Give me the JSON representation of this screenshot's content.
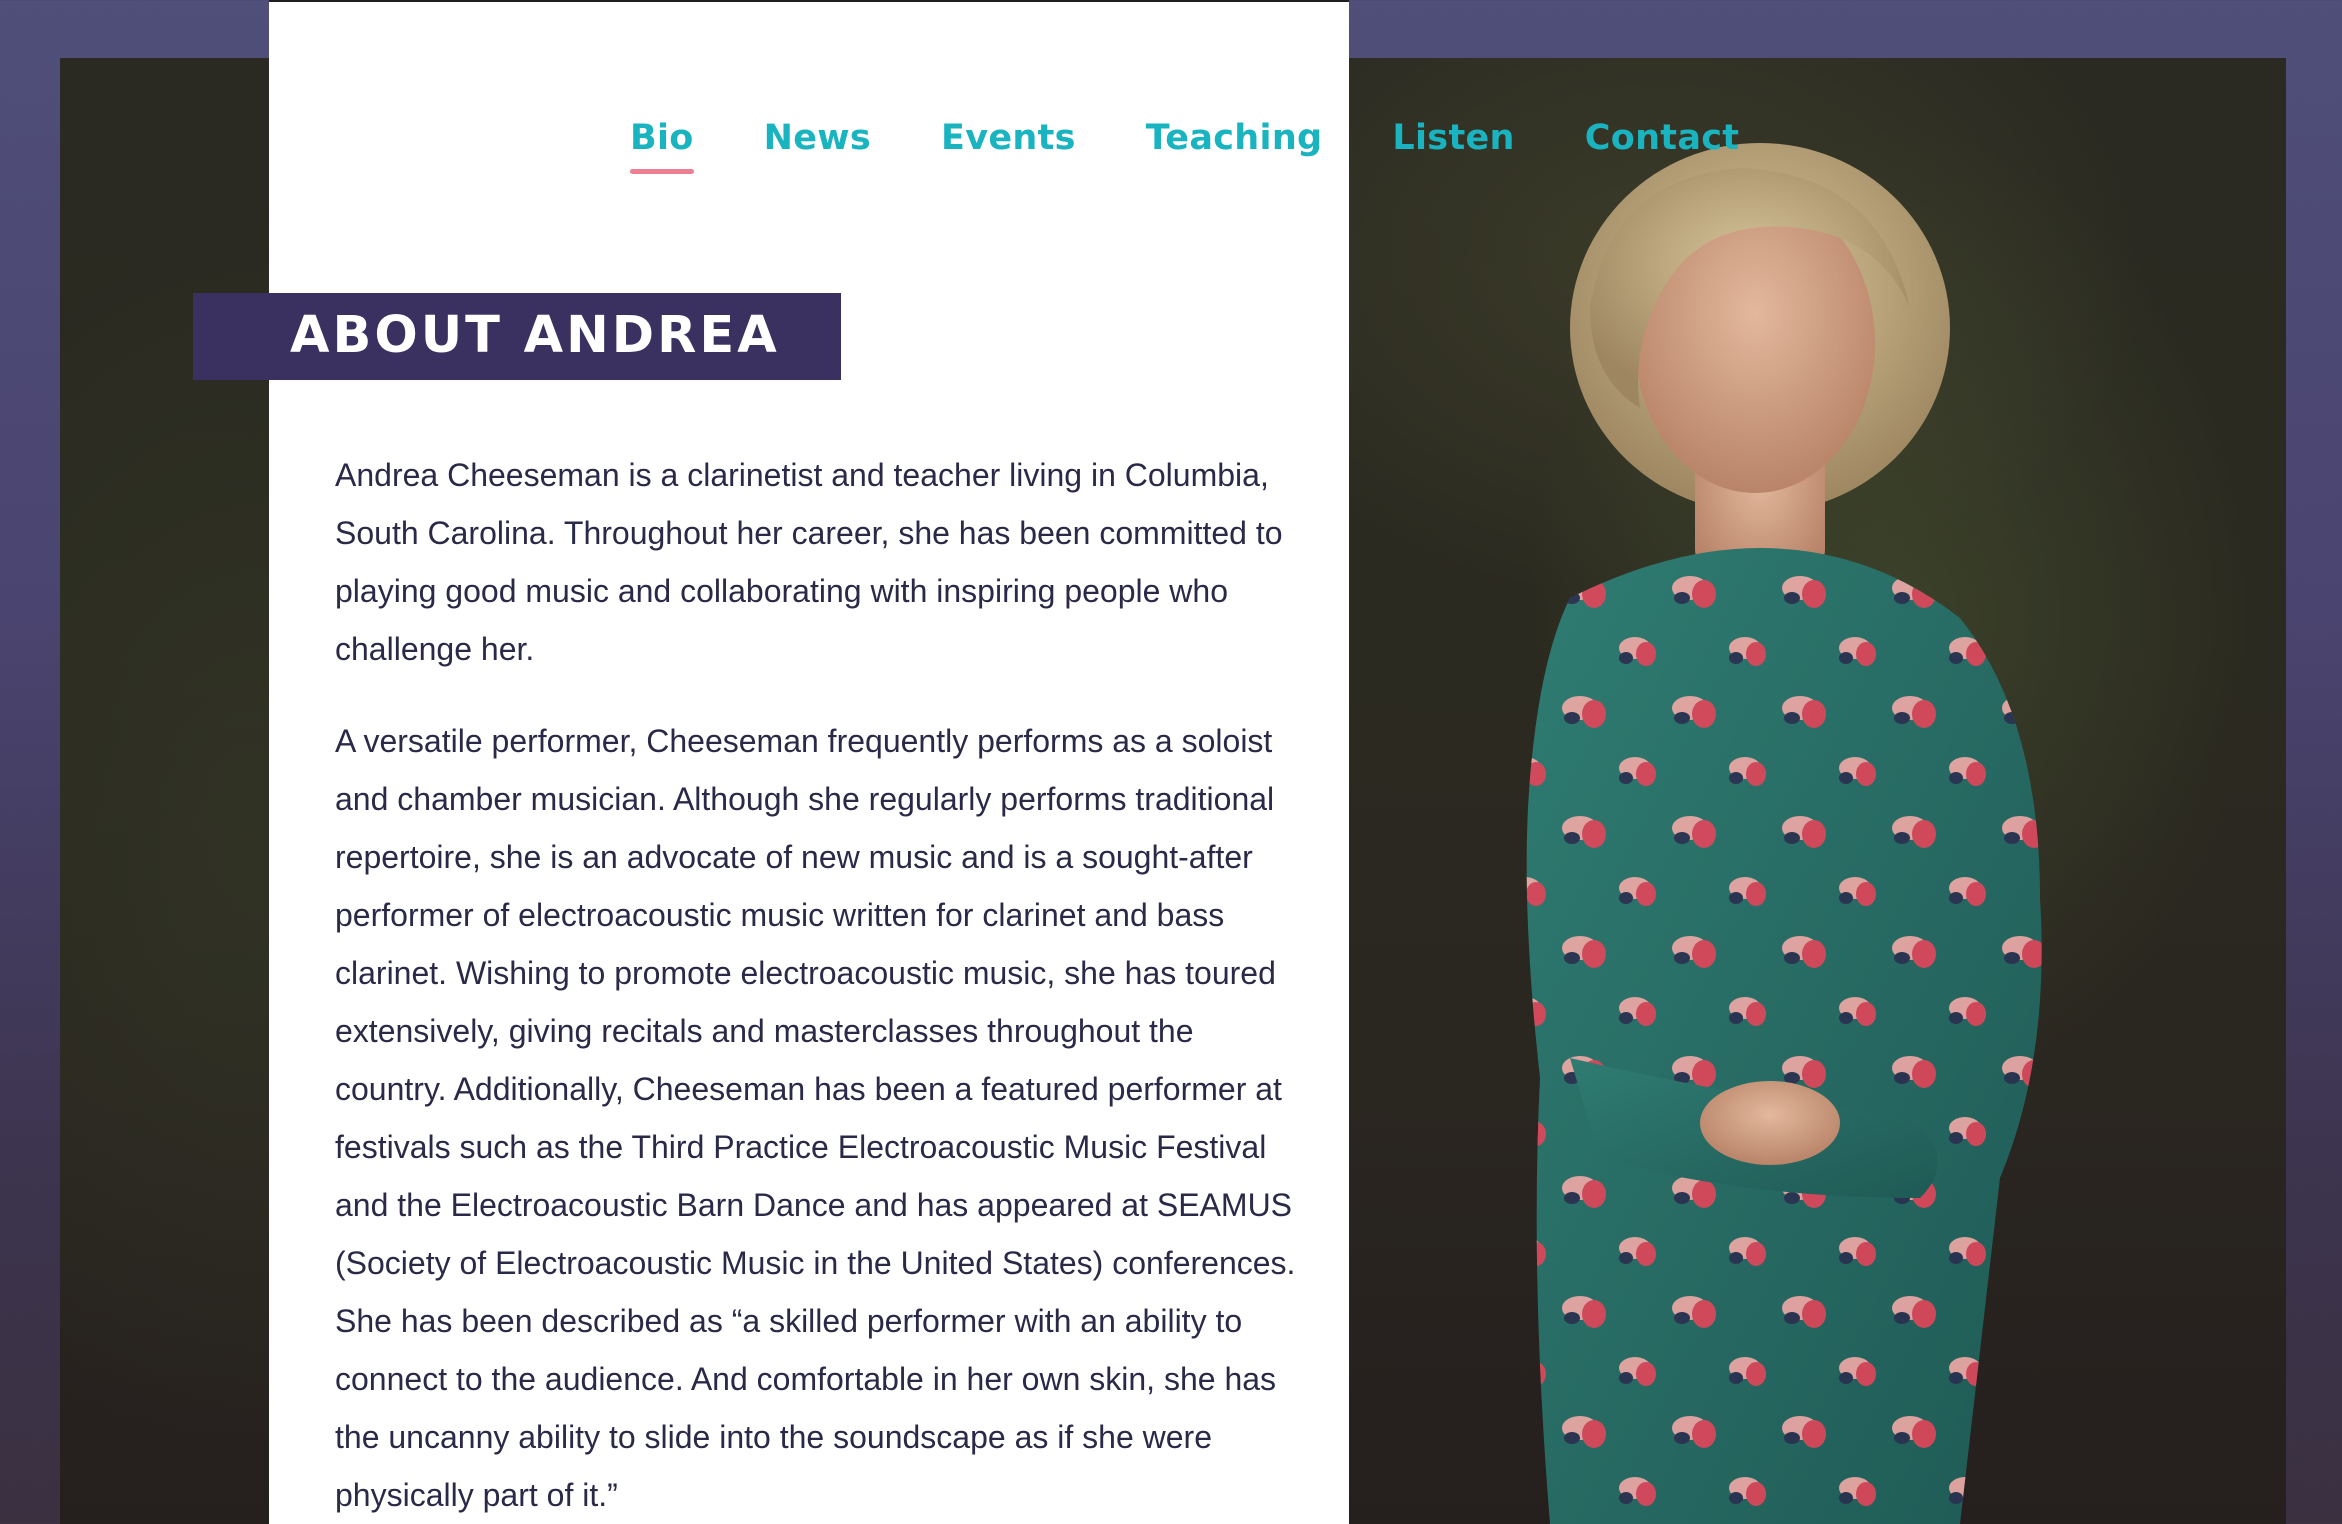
{
  "nav": {
    "items": [
      {
        "label": "Bio",
        "active": true
      },
      {
        "label": "News",
        "active": false
      },
      {
        "label": "Events",
        "active": false
      },
      {
        "label": "Teaching",
        "active": false
      },
      {
        "label": "Listen",
        "active": false
      },
      {
        "label": "Contact",
        "active": false
      }
    ]
  },
  "heading": "ABOUT ANDREA",
  "bio": {
    "paragraphs": [
      "Andrea Cheeseman is a clarinetist and teacher living in Columbia, South Carolina. Throughout her career, she has been committed to playing good music and collaborating with inspiring people who challenge her.",
      "A versatile performer, Cheeseman frequently performs as a soloist and chamber musician. Although she regularly performs traditional repertoire, she is an advocate of new music and is a sought-after performer of electroacoustic music written for clarinet and bass clarinet. Wishing to promote electroacoustic music, she has toured extensively, giving recitals and masterclasses throughout the country. Additionally, Cheeseman has been a featured performer at festivals such as the Third Practice Electroacoustic Music Festival and the Electroacoustic Barn Dance and has appeared at SEAMUS (Society of Electroacoustic Music in the United States) conferences. She has been described as “a skilled performer with an ability to connect to the audience. And comfortable in her own skin, she has the uncanny ability to slide into the soundscape as if she were physically part of it.”"
    ]
  },
  "colors": {
    "accent": "#19b4bf",
    "active_underline": "#ee7f92",
    "banner": "#3b3160",
    "frame": "#4f4f79",
    "text": "#2a2a48"
  }
}
